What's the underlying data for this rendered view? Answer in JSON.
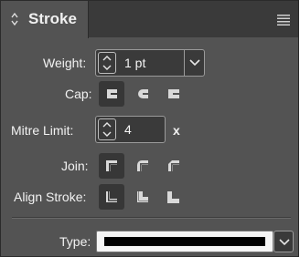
{
  "panel": {
    "title": "Stroke",
    "tab_icon": "up-down-arrows-icon",
    "menu_icon": "panel-menu-icon"
  },
  "weight": {
    "label": "Weight:",
    "value": "1 pt",
    "stepper_icon": "stepper-arrows-icon",
    "dropdown_icon": "chevron-down-icon"
  },
  "cap": {
    "label": "Cap:",
    "options": [
      {
        "name": "butt-cap-icon",
        "selected": true
      },
      {
        "name": "round-cap-icon",
        "selected": false
      },
      {
        "name": "projecting-cap-icon",
        "selected": false
      }
    ]
  },
  "mitre": {
    "label": "Mitre Limit:",
    "value": "4",
    "unit": "x"
  },
  "join": {
    "label": "Join:",
    "options": [
      {
        "name": "miter-join-icon",
        "selected": true
      },
      {
        "name": "round-join-icon",
        "selected": false
      },
      {
        "name": "bevel-join-icon",
        "selected": false
      }
    ]
  },
  "align_stroke": {
    "label": "Align Stroke:",
    "options": [
      {
        "name": "align-center-icon",
        "selected": true
      },
      {
        "name": "align-inside-icon",
        "selected": false
      },
      {
        "name": "align-outside-icon",
        "selected": false
      }
    ]
  },
  "type": {
    "label": "Type:",
    "value_color": "#000000",
    "dropdown_icon": "chevron-down-icon"
  },
  "colors": {
    "panel_bg": "#535353",
    "titlebar_bg": "#3a3a3a",
    "field_bg": "#3a3a3a",
    "selected_bg": "#373737",
    "text": "#f2f2f2"
  }
}
